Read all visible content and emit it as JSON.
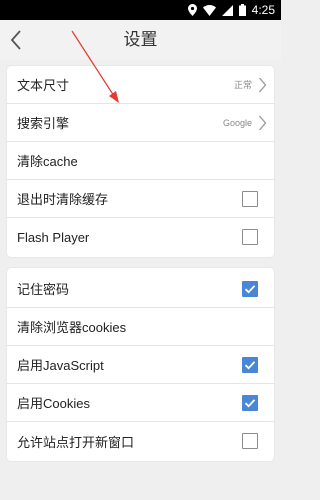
{
  "status_bar": {
    "time": "4:25"
  },
  "header": {
    "title": "设置"
  },
  "sections": [
    {
      "rows": [
        {
          "label": "文本尺寸",
          "value": "正常",
          "type": "chevron"
        },
        {
          "label": "搜索引擎",
          "value": "Google",
          "type": "chevron"
        },
        {
          "label": "清除cache",
          "type": "plain"
        },
        {
          "label": "退出时清除缓存",
          "type": "checkbox",
          "checked": false
        },
        {
          "label": "Flash Player",
          "type": "checkbox",
          "checked": false
        }
      ]
    },
    {
      "rows": [
        {
          "label": "记住密码",
          "type": "checkbox",
          "checked": true
        },
        {
          "label": "清除浏览器cookies",
          "type": "plain"
        },
        {
          "label": "启用JavaScript",
          "type": "checkbox",
          "checked": true
        },
        {
          "label": "启用Cookies",
          "type": "checkbox",
          "checked": true
        },
        {
          "label": "允许站点打开新窗口",
          "type": "checkbox",
          "checked": false
        }
      ]
    }
  ],
  "colors": {
    "accent": "#4a86d8",
    "annotation_arrow": "#e53935",
    "background": "#efefef"
  }
}
